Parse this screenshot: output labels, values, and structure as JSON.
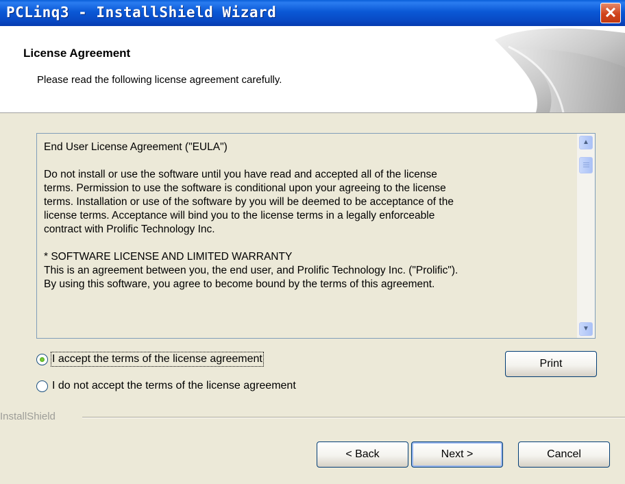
{
  "window": {
    "title": "PCLinq3 - InstallShield Wizard",
    "close_glyph": "✕"
  },
  "header": {
    "title": "License Agreement",
    "subtitle": "Please read the following license agreement carefully."
  },
  "license": {
    "paragraphs": [
      [
        "End User License Agreement (\"EULA\")"
      ],
      [
        "Do not install or use the software until you have read and accepted all of the license",
        "terms. Permission to use the software is conditional upon your agreeing to the license",
        "terms. Installation or use of the software by you will be deemed to be acceptance of the",
        "license terms. Acceptance will bind you to the license terms in a legally enforceable",
        "contract with Prolific Technology Inc."
      ],
      [
        "* SOFTWARE LICENSE AND LIMITED WARRANTY",
        "This is an agreement between you, the end user, and Prolific Technology Inc. (\"Prolific\").",
        "By using this software, you agree to become bound by the terms of this agreement."
      ]
    ],
    "scroll_up_glyph": "▲",
    "scroll_down_glyph": "▼"
  },
  "options": {
    "accept_label": "I accept the terms of the license agreement",
    "decline_label": "I do not accept the terms of the license agreement",
    "selected": "accept"
  },
  "divider": {
    "label": "InstallShield"
  },
  "buttons": {
    "print": "Print",
    "back": "< Back",
    "next": "Next >",
    "cancel": "Cancel"
  },
  "colors": {
    "title_bar": "#0a58d6",
    "dialog_bg": "#ece9d8",
    "button_border": "#003c74"
  }
}
